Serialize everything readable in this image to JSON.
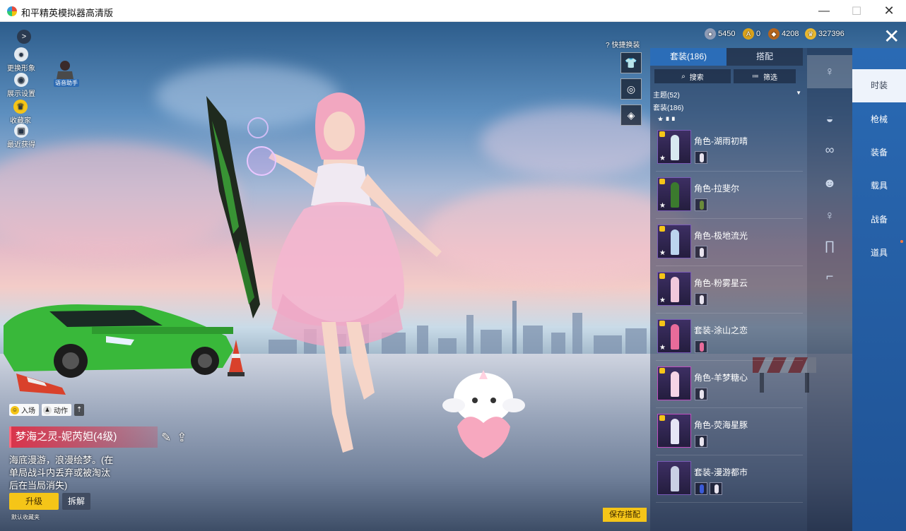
{
  "window": {
    "title": "和平精英模拟器高清版",
    "minimize_glyph": "—",
    "maximize_glyph": "☐",
    "close_glyph": "✕"
  },
  "currency": [
    {
      "icon": "silver-coin-icon",
      "value": "5450",
      "color": "#8e9bb5"
    },
    {
      "icon": "gold-a-coin-icon",
      "value": "0",
      "color": "#d9a21b"
    },
    {
      "icon": "medal-coin-icon",
      "value": "4208",
      "color": "#b5651d"
    },
    {
      "icon": "crown-coin-icon",
      "value": "327396",
      "color": "#e8b830"
    }
  ],
  "left_tools": {
    "change_look": "更换形象",
    "display_settings": "展示设置",
    "collector": "收藏家",
    "recent": "最近获得",
    "voice_assistant": "语音助手"
  },
  "bottom_info": {
    "entrance_tag": "入场",
    "action_tag": "动作",
    "item_name": "梦海之灵-妮芮妲(4级)",
    "description": "海底漫游，浪漫绘梦。(在单局战斗内丢弃或被淘汰后在当局消失)",
    "upgrade": "升级",
    "dismantle": "拆解",
    "default_favorite": "默认收藏夹"
  },
  "quick_swap_label": "快捷换装",
  "panel": {
    "tabs": [
      "套装(186)",
      "搭配"
    ],
    "search": "搜索",
    "filter": "筛选",
    "theme": "主题(52)",
    "suit_count": "套装(186)",
    "items": [
      {
        "name": "角色-湖雨初晴",
        "color": "#d7e8f0"
      },
      {
        "name": "角色-拉斐尔",
        "color": "#3b7a2e"
      },
      {
        "name": "角色-极地流光",
        "color": "#bcd4ee"
      },
      {
        "name": "角色-粉雾星云",
        "color": "#f1c9dc"
      },
      {
        "name": "套装-涂山之恋",
        "color": "#e86b9a"
      },
      {
        "name": "角色-羊梦糖心",
        "color": "#f6d4e6"
      },
      {
        "name": "角色-荧海星豚",
        "color": "#e6e6f5"
      },
      {
        "name": "套装-漫游都市",
        "color": "#c9d0e4"
      }
    ],
    "save": "保存搭配"
  },
  "categories": [
    "时装",
    "枪械",
    "装备",
    "载具",
    "战备",
    "道具"
  ],
  "category_icons": [
    "character-icon",
    "cap-icon",
    "glasses-icon",
    "mask-icon",
    "outfit-icon",
    "pants-icon",
    "shoes-icon"
  ]
}
